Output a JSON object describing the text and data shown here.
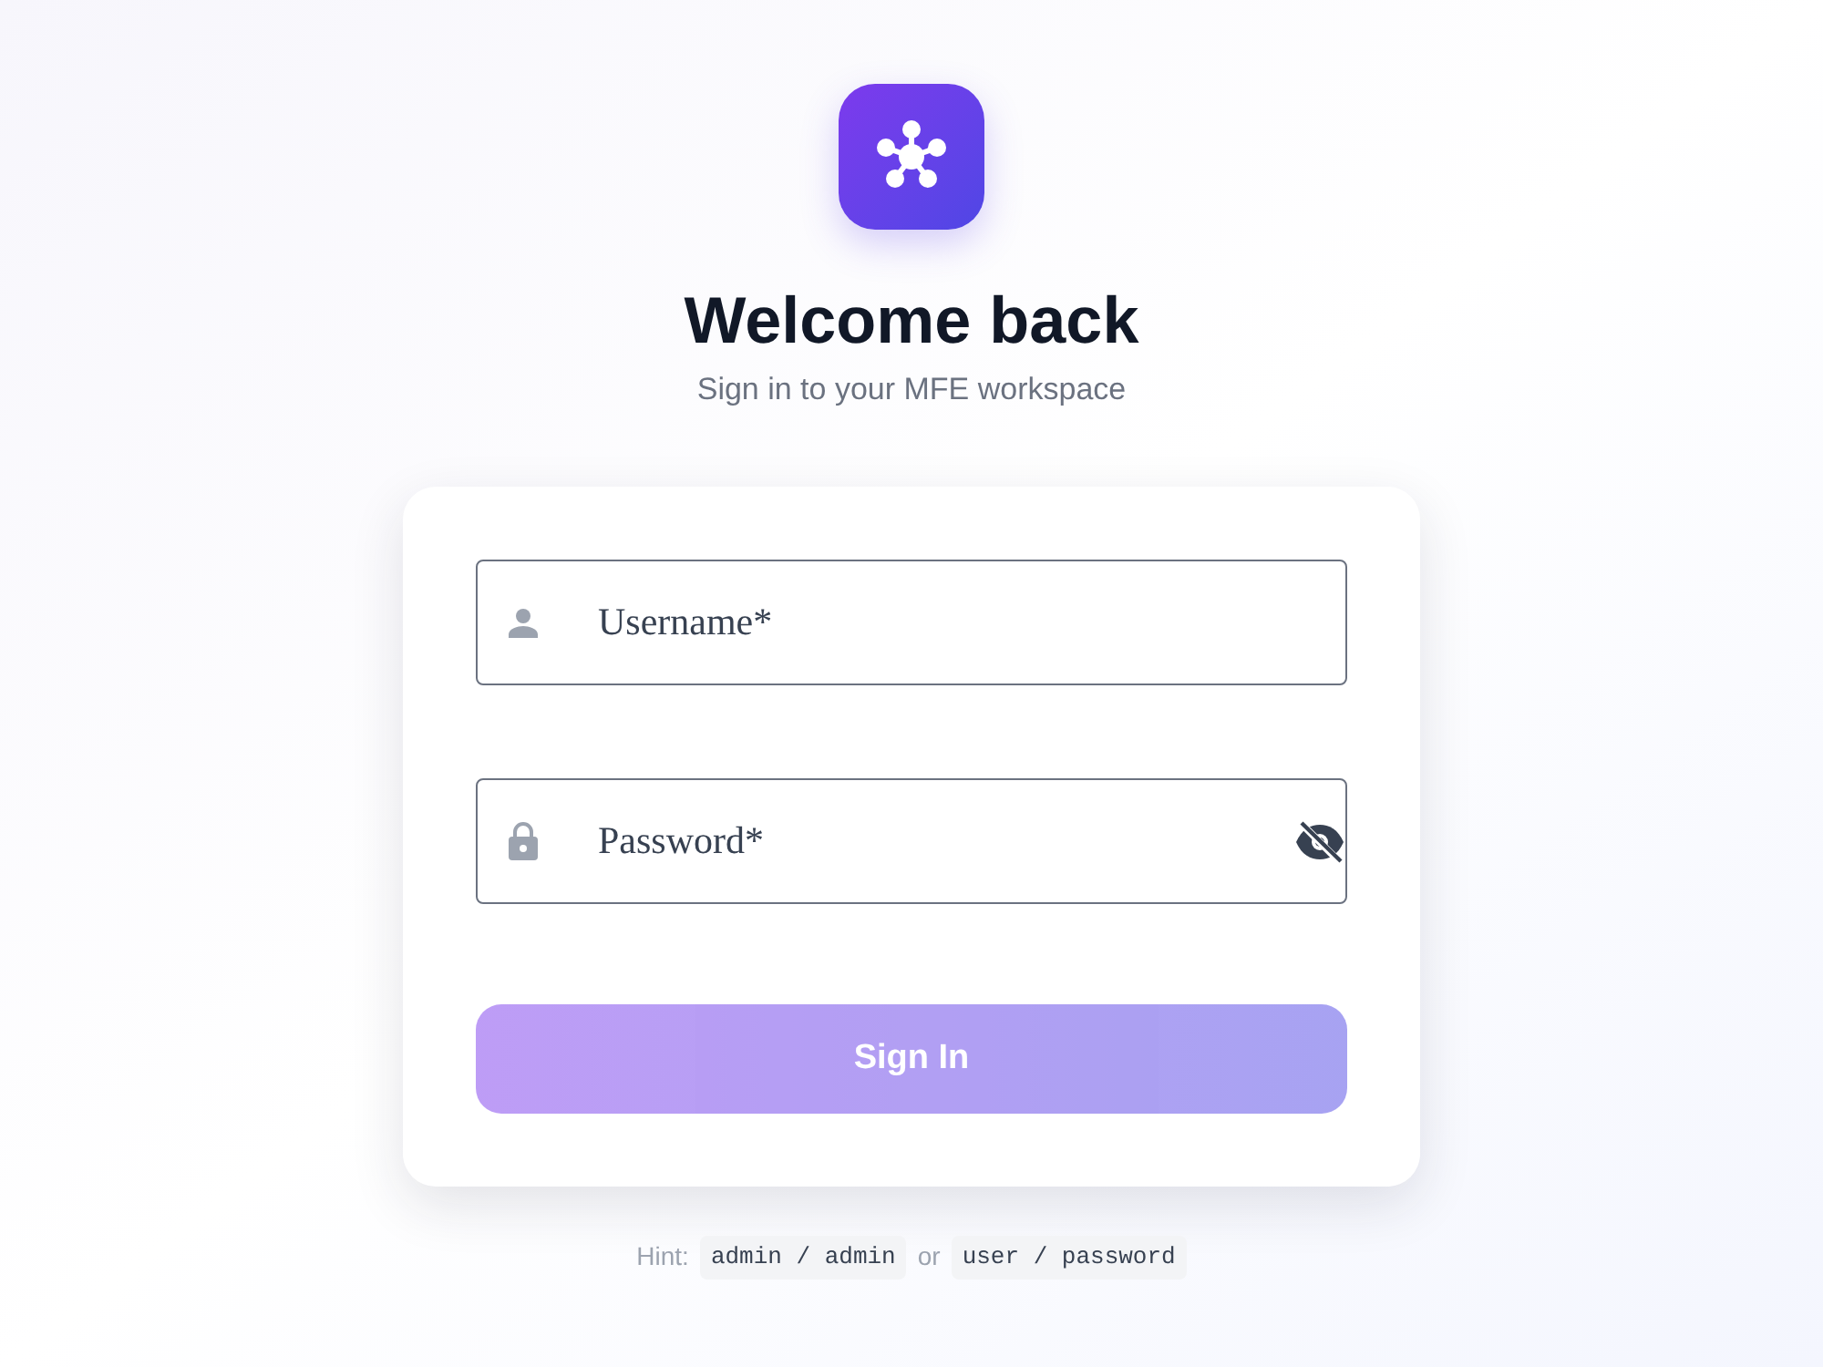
{
  "header": {
    "title": "Welcome back",
    "subtitle": "Sign in to your MFE workspace"
  },
  "fields": [
    {
      "kind": "text",
      "placeholder": "Username*"
    },
    {
      "kind": "password",
      "placeholder": "Password*",
      "password_visible": false
    }
  ],
  "submit": {
    "label": "Sign In",
    "disabled": true
  },
  "hint": {
    "label": "Hint:",
    "separator": "or",
    "credentials": [
      "admin / admin",
      "user / password"
    ]
  }
}
